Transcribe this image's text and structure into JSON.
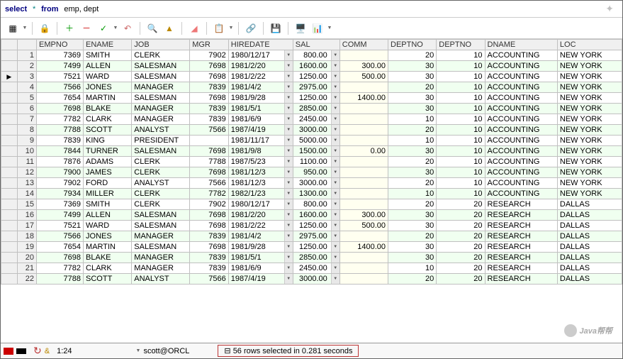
{
  "sql": {
    "keyword1": "select",
    "star": "*",
    "keyword2": "from",
    "tables": "emp, dept"
  },
  "columns": [
    "EMPNO",
    "ENAME",
    "JOB",
    "MGR",
    "HIREDATE",
    "SAL",
    "COMM",
    "DEPTNO",
    "DEPTNO",
    "DNAME",
    "LOC"
  ],
  "rows": [
    {
      "empno": "7369",
      "ename": "SMITH",
      "job": "CLERK",
      "mgr": "7902",
      "hiredate": "1980/12/17",
      "sal": "800.00",
      "comm": "",
      "deptno1": "20",
      "deptno2": "10",
      "dname": "ACCOUNTING",
      "loc": "NEW YORK"
    },
    {
      "empno": "7499",
      "ename": "ALLEN",
      "job": "SALESMAN",
      "mgr": "7698",
      "hiredate": "1981/2/20",
      "sal": "1600.00",
      "comm": "300.00",
      "deptno1": "30",
      "deptno2": "10",
      "dname": "ACCOUNTING",
      "loc": "NEW YORK"
    },
    {
      "empno": "7521",
      "ename": "WARD",
      "job": "SALESMAN",
      "mgr": "7698",
      "hiredate": "1981/2/22",
      "sal": "1250.00",
      "comm": "500.00",
      "deptno1": "30",
      "deptno2": "10",
      "dname": "ACCOUNTING",
      "loc": "NEW YORK"
    },
    {
      "empno": "7566",
      "ename": "JONES",
      "job": "MANAGER",
      "mgr": "7839",
      "hiredate": "1981/4/2",
      "sal": "2975.00",
      "comm": "",
      "deptno1": "20",
      "deptno2": "10",
      "dname": "ACCOUNTING",
      "loc": "NEW YORK"
    },
    {
      "empno": "7654",
      "ename": "MARTIN",
      "job": "SALESMAN",
      "mgr": "7698",
      "hiredate": "1981/9/28",
      "sal": "1250.00",
      "comm": "1400.00",
      "deptno1": "30",
      "deptno2": "10",
      "dname": "ACCOUNTING",
      "loc": "NEW YORK"
    },
    {
      "empno": "7698",
      "ename": "BLAKE",
      "job": "MANAGER",
      "mgr": "7839",
      "hiredate": "1981/5/1",
      "sal": "2850.00",
      "comm": "",
      "deptno1": "30",
      "deptno2": "10",
      "dname": "ACCOUNTING",
      "loc": "NEW YORK"
    },
    {
      "empno": "7782",
      "ename": "CLARK",
      "job": "MANAGER",
      "mgr": "7839",
      "hiredate": "1981/6/9",
      "sal": "2450.00",
      "comm": "",
      "deptno1": "10",
      "deptno2": "10",
      "dname": "ACCOUNTING",
      "loc": "NEW YORK"
    },
    {
      "empno": "7788",
      "ename": "SCOTT",
      "job": "ANALYST",
      "mgr": "7566",
      "hiredate": "1987/4/19",
      "sal": "3000.00",
      "comm": "",
      "deptno1": "20",
      "deptno2": "10",
      "dname": "ACCOUNTING",
      "loc": "NEW YORK"
    },
    {
      "empno": "7839",
      "ename": "KING",
      "job": "PRESIDENT",
      "mgr": "",
      "hiredate": "1981/11/17",
      "sal": "5000.00",
      "comm": "",
      "deptno1": "10",
      "deptno2": "10",
      "dname": "ACCOUNTING",
      "loc": "NEW YORK"
    },
    {
      "empno": "7844",
      "ename": "TURNER",
      "job": "SALESMAN",
      "mgr": "7698",
      "hiredate": "1981/9/8",
      "sal": "1500.00",
      "comm": "0.00",
      "deptno1": "30",
      "deptno2": "10",
      "dname": "ACCOUNTING",
      "loc": "NEW YORK"
    },
    {
      "empno": "7876",
      "ename": "ADAMS",
      "job": "CLERK",
      "mgr": "7788",
      "hiredate": "1987/5/23",
      "sal": "1100.00",
      "comm": "",
      "deptno1": "20",
      "deptno2": "10",
      "dname": "ACCOUNTING",
      "loc": "NEW YORK"
    },
    {
      "empno": "7900",
      "ename": "JAMES",
      "job": "CLERK",
      "mgr": "7698",
      "hiredate": "1981/12/3",
      "sal": "950.00",
      "comm": "",
      "deptno1": "30",
      "deptno2": "10",
      "dname": "ACCOUNTING",
      "loc": "NEW YORK"
    },
    {
      "empno": "7902",
      "ename": "FORD",
      "job": "ANALYST",
      "mgr": "7566",
      "hiredate": "1981/12/3",
      "sal": "3000.00",
      "comm": "",
      "deptno1": "20",
      "deptno2": "10",
      "dname": "ACCOUNTING",
      "loc": "NEW YORK"
    },
    {
      "empno": "7934",
      "ename": "MILLER",
      "job": "CLERK",
      "mgr": "7782",
      "hiredate": "1982/1/23",
      "sal": "1300.00",
      "comm": "",
      "deptno1": "10",
      "deptno2": "10",
      "dname": "ACCOUNTING",
      "loc": "NEW YORK"
    },
    {
      "empno": "7369",
      "ename": "SMITH",
      "job": "CLERK",
      "mgr": "7902",
      "hiredate": "1980/12/17",
      "sal": "800.00",
      "comm": "",
      "deptno1": "20",
      "deptno2": "20",
      "dname": "RESEARCH",
      "loc": "DALLAS"
    },
    {
      "empno": "7499",
      "ename": "ALLEN",
      "job": "SALESMAN",
      "mgr": "7698",
      "hiredate": "1981/2/20",
      "sal": "1600.00",
      "comm": "300.00",
      "deptno1": "30",
      "deptno2": "20",
      "dname": "RESEARCH",
      "loc": "DALLAS"
    },
    {
      "empno": "7521",
      "ename": "WARD",
      "job": "SALESMAN",
      "mgr": "7698",
      "hiredate": "1981/2/22",
      "sal": "1250.00",
      "comm": "500.00",
      "deptno1": "30",
      "deptno2": "20",
      "dname": "RESEARCH",
      "loc": "DALLAS"
    },
    {
      "empno": "7566",
      "ename": "JONES",
      "job": "MANAGER",
      "mgr": "7839",
      "hiredate": "1981/4/2",
      "sal": "2975.00",
      "comm": "",
      "deptno1": "20",
      "deptno2": "20",
      "dname": "RESEARCH",
      "loc": "DALLAS"
    },
    {
      "empno": "7654",
      "ename": "MARTIN",
      "job": "SALESMAN",
      "mgr": "7698",
      "hiredate": "1981/9/28",
      "sal": "1250.00",
      "comm": "1400.00",
      "deptno1": "30",
      "deptno2": "20",
      "dname": "RESEARCH",
      "loc": "DALLAS"
    },
    {
      "empno": "7698",
      "ename": "BLAKE",
      "job": "MANAGER",
      "mgr": "7839",
      "hiredate": "1981/5/1",
      "sal": "2850.00",
      "comm": "",
      "deptno1": "30",
      "deptno2": "20",
      "dname": "RESEARCH",
      "loc": "DALLAS"
    },
    {
      "empno": "7782",
      "ename": "CLARK",
      "job": "MANAGER",
      "mgr": "7839",
      "hiredate": "1981/6/9",
      "sal": "2450.00",
      "comm": "",
      "deptno1": "10",
      "deptno2": "20",
      "dname": "RESEARCH",
      "loc": "DALLAS"
    },
    {
      "empno": "7788",
      "ename": "SCOTT",
      "job": "ANALYST",
      "mgr": "7566",
      "hiredate": "1987/4/19",
      "sal": "3000.00",
      "comm": "",
      "deptno1": "20",
      "deptno2": "20",
      "dname": "RESEARCH",
      "loc": "DALLAS"
    }
  ],
  "currentRow": 3,
  "status": {
    "cursor": "1:24",
    "connection": "scott@ORCL",
    "result": "56 rows selected in 0.281 seconds"
  },
  "watermark": "Java帮帮"
}
